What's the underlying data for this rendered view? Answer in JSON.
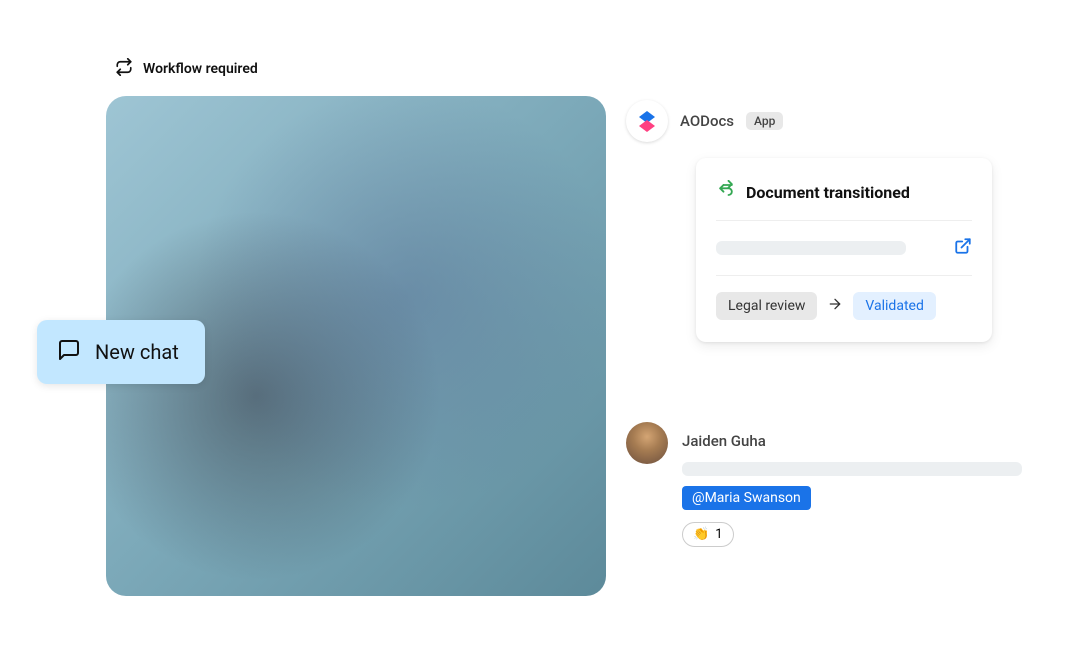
{
  "header": {
    "workflow_label": "Workflow required"
  },
  "new_chat": {
    "label": "New chat"
  },
  "app": {
    "name": "AODocs",
    "tag": "App"
  },
  "doc_card": {
    "title": "Document transitioned",
    "status_from": "Legal review",
    "status_to": "Validated"
  },
  "message": {
    "author": "Jaiden Guha",
    "mention": "@Maria Swanson",
    "reaction_emoji": "👏",
    "reaction_count": "1"
  }
}
